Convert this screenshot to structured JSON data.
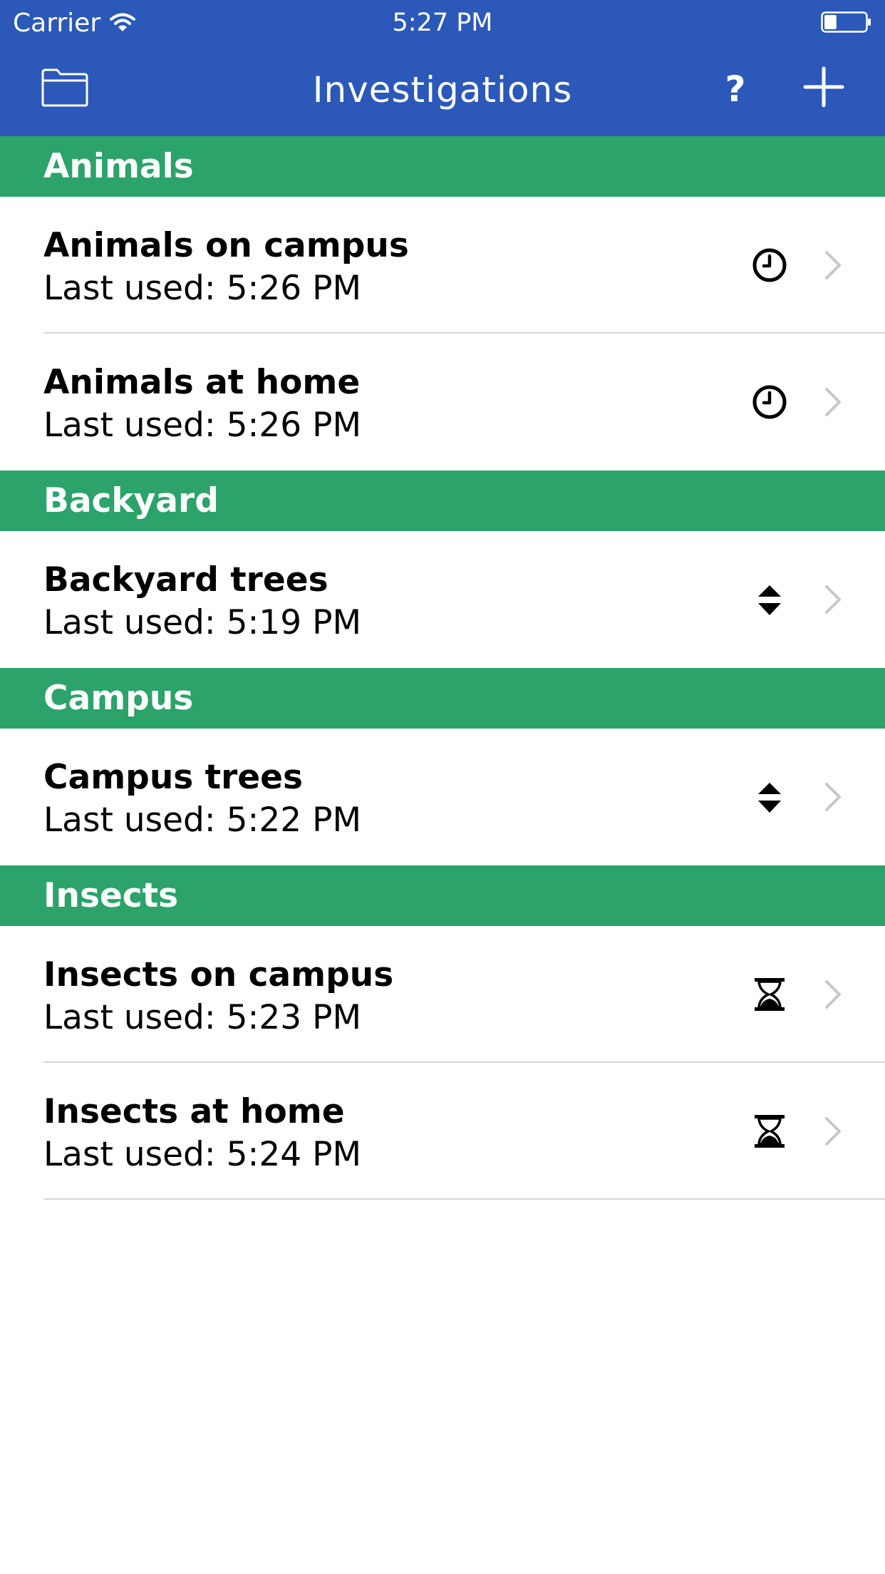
{
  "status_bar": {
    "carrier": "Carrier",
    "time": "5:27 PM",
    "battery_level": 0.3
  },
  "nav": {
    "title": "Investigations",
    "help_label": "?",
    "left_icon": "folder-icon",
    "right_icon": "plus-icon"
  },
  "colors": {
    "nav_background": "#2b58b9",
    "section_background": "#2ca36a",
    "separator": "#d6d6d6",
    "chevron": "#c7c7cc"
  },
  "sections": [
    {
      "title": "Animals",
      "items": [
        {
          "title": "Animals on campus",
          "subtitle": "Last used: 5:26 PM",
          "icon": "clock-icon"
        },
        {
          "title": "Animals at home",
          "subtitle": "Last used: 5:26 PM",
          "icon": "clock-icon"
        }
      ]
    },
    {
      "title": "Backyard",
      "items": [
        {
          "title": "Backyard trees",
          "subtitle": "Last used: 5:19 PM",
          "icon": "sort-icon"
        }
      ]
    },
    {
      "title": "Campus",
      "items": [
        {
          "title": "Campus trees",
          "subtitle": "Last used: 5:22 PM",
          "icon": "sort-icon"
        }
      ]
    },
    {
      "title": "Insects",
      "items": [
        {
          "title": "Insects on campus",
          "subtitle": "Last used: 5:23 PM",
          "icon": "hourglass-icon"
        },
        {
          "title": "Insects at home",
          "subtitle": "Last used: 5:24 PM",
          "icon": "hourglass-icon"
        }
      ]
    }
  ]
}
